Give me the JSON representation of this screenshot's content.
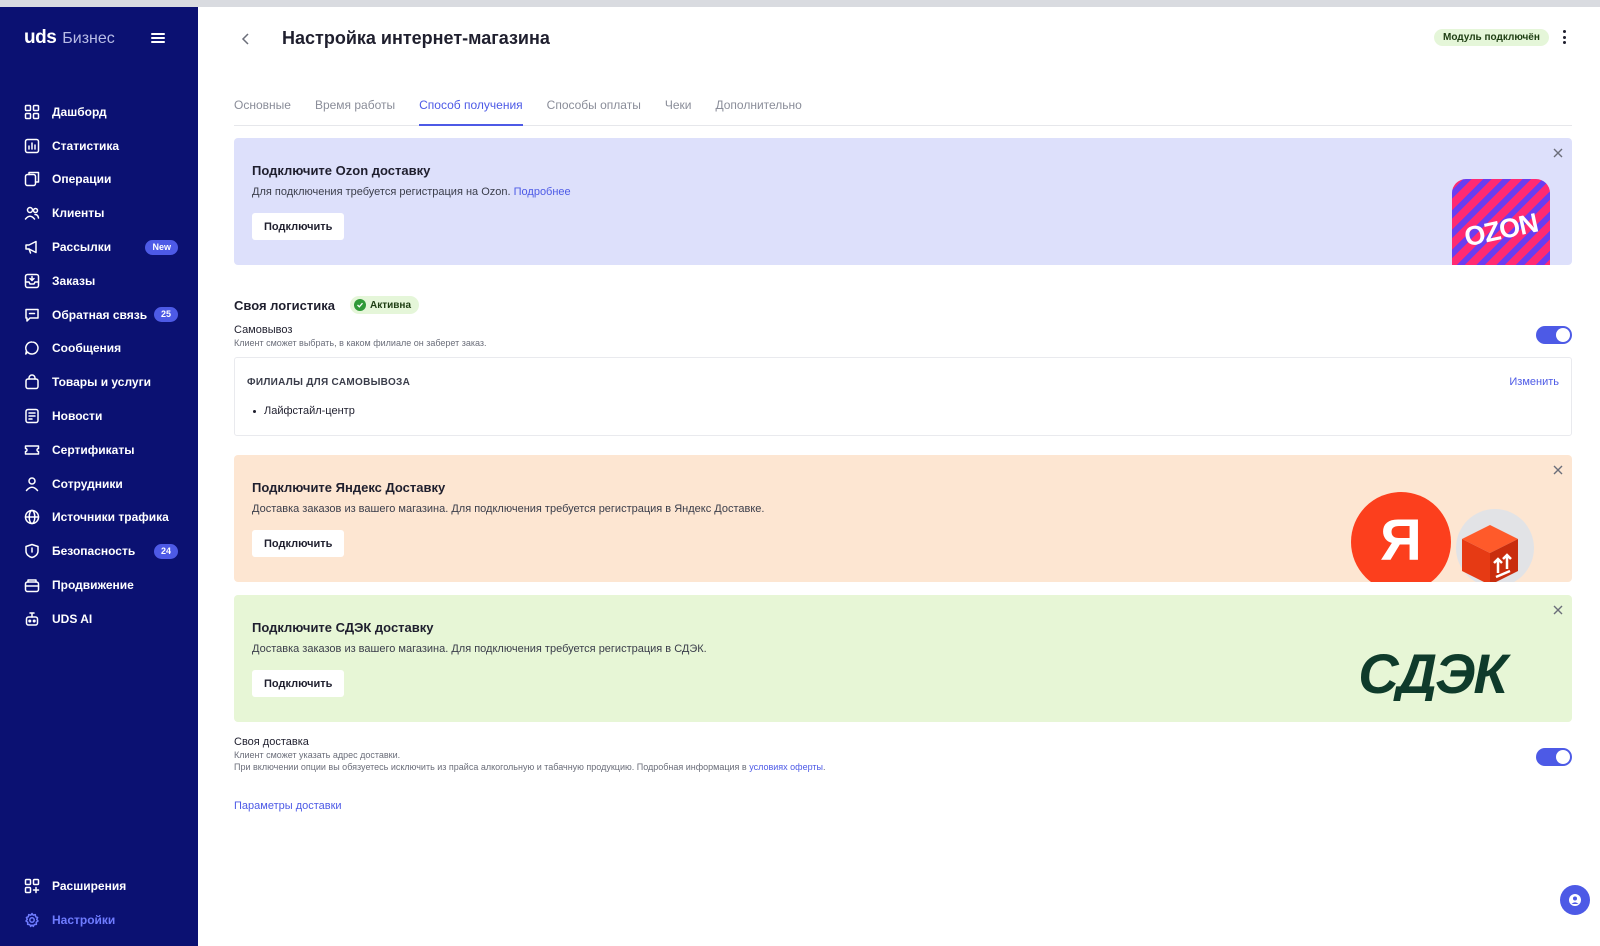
{
  "sidebar": {
    "logo_main": "uds",
    "logo_sub": "Бизнес",
    "items": [
      {
        "label": "Дашборд",
        "icon": "dashboard-icon"
      },
      {
        "label": "Статистика",
        "icon": "chart-icon"
      },
      {
        "label": "Операции",
        "icon": "operations-icon"
      },
      {
        "label": "Клиенты",
        "icon": "users-icon"
      },
      {
        "label": "Рассылки",
        "icon": "megaphone-icon",
        "badge": "New"
      },
      {
        "label": "Заказы",
        "icon": "orders-icon"
      },
      {
        "label": "Обратная связь",
        "icon": "feedback-icon",
        "badge": "25"
      },
      {
        "label": "Сообщения",
        "icon": "chat-bubble-icon"
      },
      {
        "label": "Товары и услуги",
        "icon": "bag-icon"
      },
      {
        "label": "Новости",
        "icon": "news-icon"
      },
      {
        "label": "Сертификаты",
        "icon": "ticket-icon"
      },
      {
        "label": "Сотрудники",
        "icon": "person-icon"
      },
      {
        "label": "Источники трафика",
        "icon": "globe-icon"
      },
      {
        "label": "Безопасность",
        "icon": "shield-icon",
        "badge": "24"
      },
      {
        "label": "Продвижение",
        "icon": "promo-icon"
      },
      {
        "label": "UDS AI",
        "icon": "robot-icon"
      }
    ],
    "bottom_items": [
      {
        "label": "Расширения",
        "icon": "extensions-icon"
      },
      {
        "label": "Настройки",
        "icon": "gear-icon",
        "active": true
      }
    ]
  },
  "header": {
    "title": "Настройка интернет-магазина",
    "module_status": "Модуль подключён"
  },
  "tabs": [
    {
      "label": "Основные"
    },
    {
      "label": "Время работы"
    },
    {
      "label": "Способ получения",
      "active": true
    },
    {
      "label": "Способы оплаты"
    },
    {
      "label": "Чеки"
    },
    {
      "label": "Дополнительно"
    }
  ],
  "ozon": {
    "title": "Подключите Ozon доставку",
    "desc": "Для подключения требуется регистрация на Ozon.",
    "link": "Подробнее",
    "button": "Подключить",
    "logo_text": "OZON"
  },
  "logistics": {
    "title": "Своя логистика",
    "status": "Активна",
    "pickup_title": "Самовывоз",
    "pickup_desc": "Клиент сможет выбрать, в каком филиале он заберет заказ.",
    "branches_title": "ФИЛИАЛЫ ДЛЯ САМОВЫВОЗА",
    "branches_edit": "Изменить",
    "branches": [
      "Лайфстайл-центр"
    ]
  },
  "yandex": {
    "title": "Подключите Яндекс Доставку",
    "desc": "Доставка заказов из вашего магазина. Для подключения требуется регистрация в Яндекс Доставке.",
    "button": "Подключить",
    "logo_text": "Я"
  },
  "cdek": {
    "title": "Подключите СДЭК доставку",
    "desc": "Доставка заказов из вашего магазина. Для подключения требуется регистрация в СДЭК.",
    "button": "Подключить",
    "logo_text": "СДЭК"
  },
  "own_delivery": {
    "title": "Своя доставка",
    "desc1": "Клиент сможет указать адрес доставки.",
    "desc2": "При включении опции вы обязуетесь исключить из прайса алкогольную и табачную продукцию. Подробная информация в",
    "link": "условиях оферты",
    "link_suffix": ".",
    "params_link": "Параметры доставки"
  },
  "colors": {
    "sidebar_bg": "#0b1172",
    "accent": "#4d5ae6",
    "ozon_bg": "#dde0fb",
    "yandex_bg": "#fde6d2",
    "cdek_bg": "#e7f6d6",
    "cdek_logo": "#0f3b2b"
  }
}
